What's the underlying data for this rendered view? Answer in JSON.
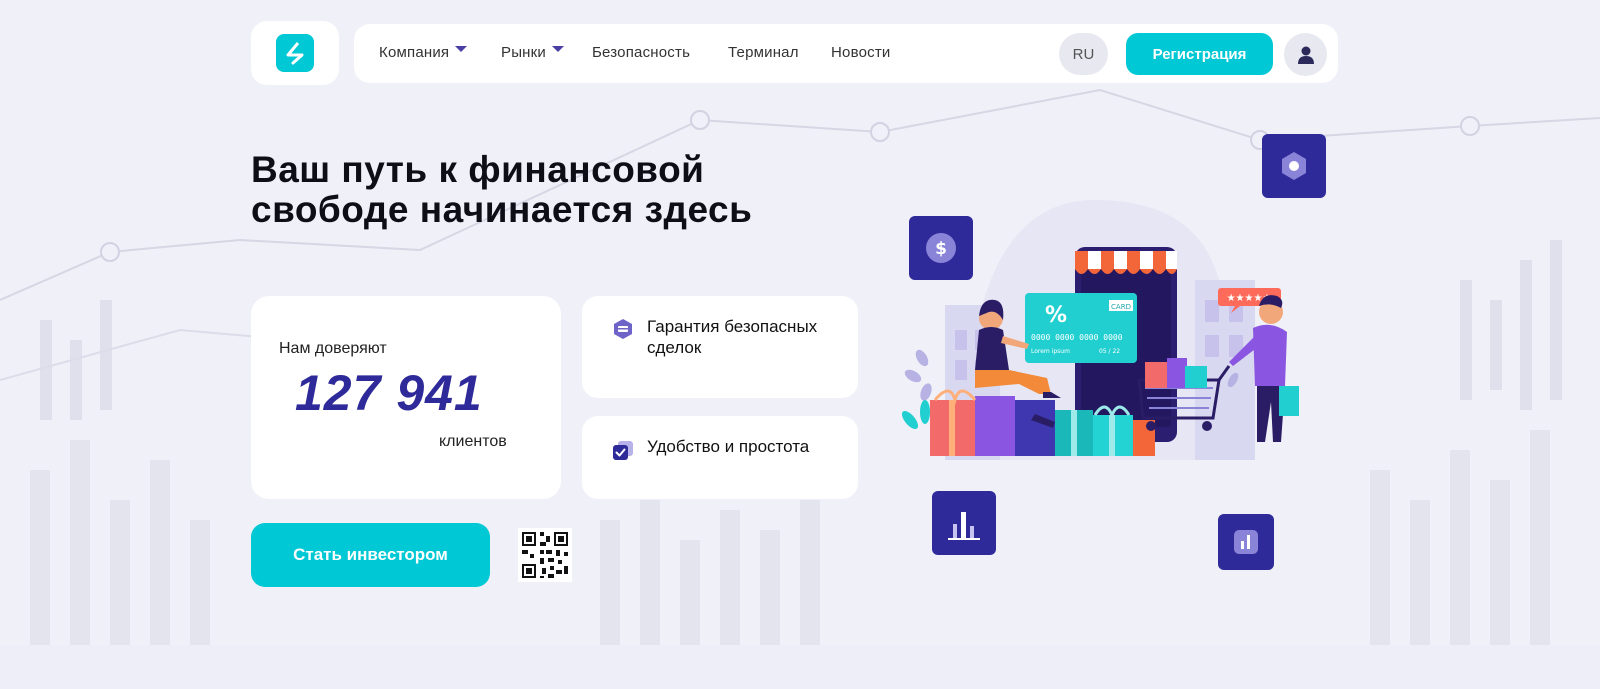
{
  "header": {
    "nav_items": [
      {
        "label": "Компания",
        "has_dropdown": true
      },
      {
        "label": "Рынки",
        "has_dropdown": true
      },
      {
        "label": "Безопасность",
        "has_dropdown": false
      },
      {
        "label": "Терминал",
        "has_dropdown": false
      },
      {
        "label": "Новости",
        "has_dropdown": false
      }
    ],
    "language": "RU",
    "register_label": "Регистрация",
    "user_icon": "user-icon",
    "logo_icon": "brand-logo-icon"
  },
  "hero": {
    "title": "Ваш путь к финансовой свободе начинается здесь",
    "trust": {
      "label": "Нам доверяют",
      "number": "127 941",
      "suffix": "клиентов"
    },
    "features": [
      {
        "text": "Гарантия безопасных сделок",
        "icon": "card-shield-icon"
      },
      {
        "text": "Удобство и простота",
        "icon": "checkbox-icon"
      }
    ],
    "cta_label": "Стать инвестором",
    "qr_icon": "qr-code-icon"
  },
  "illustration": {
    "card_percent": "%",
    "card_label": "CARD",
    "card_number": "0000 0000 0000 0000",
    "card_name": "Lorem ipsum",
    "card_expiry": "05 / 22",
    "tiles": [
      "dollar-icon",
      "hexagon-icon",
      "bar-chart-icon",
      "chart-icon"
    ]
  },
  "colors": {
    "accent": "#00c8d4",
    "brand_dark": "#2f2a9a",
    "page_bg": "#f0f0f8"
  }
}
